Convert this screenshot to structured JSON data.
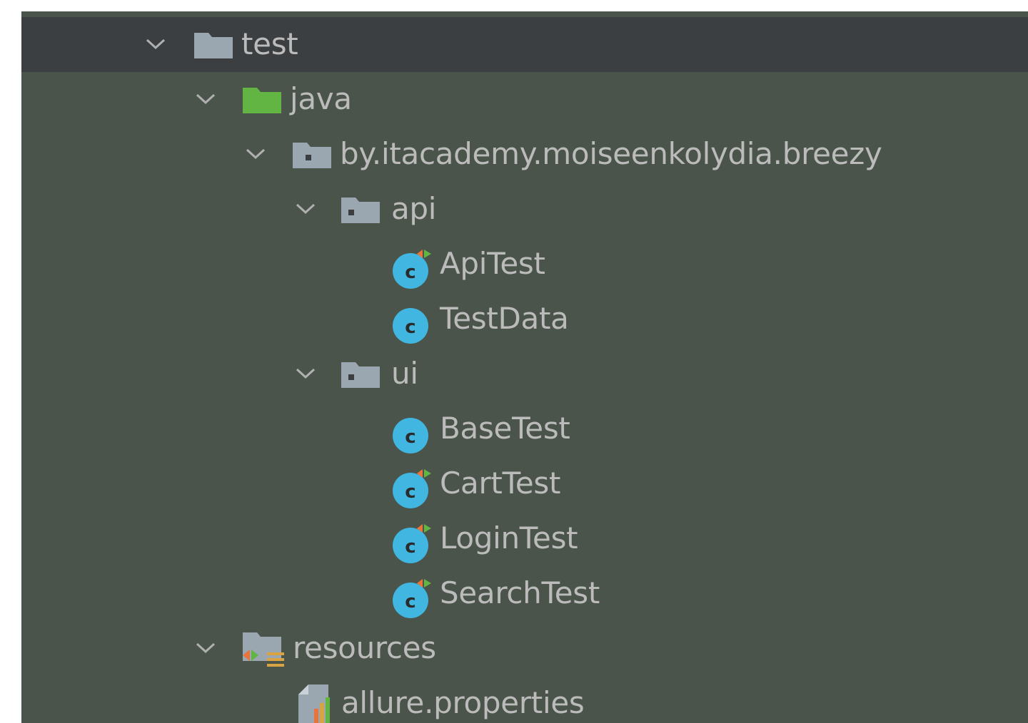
{
  "tree": {
    "root": {
      "label": "test",
      "expanded": true,
      "icon": "folder-icon"
    },
    "java": {
      "label": "java",
      "expanded": true,
      "icon": "source-root-folder-icon"
    },
    "package": {
      "label": "by.itacademy.moiseenkolydia.breezy",
      "expanded": true,
      "icon": "package-icon"
    },
    "api": {
      "label": "api",
      "expanded": true,
      "icon": "package-icon",
      "classes": [
        {
          "label": "ApiTest",
          "icon": "test-class-icon"
        },
        {
          "label": "TestData",
          "icon": "class-icon"
        }
      ]
    },
    "ui": {
      "label": "ui",
      "expanded": true,
      "icon": "package-icon",
      "classes": [
        {
          "label": "BaseTest",
          "icon": "class-icon"
        },
        {
          "label": "CartTest",
          "icon": "test-class-icon"
        },
        {
          "label": "LoginTest",
          "icon": "test-class-icon"
        },
        {
          "label": "SearchTest",
          "icon": "test-class-icon"
        }
      ]
    },
    "resources": {
      "label": "resources",
      "expanded": true,
      "icon": "resources-root-folder-icon",
      "files": [
        {
          "label": "allure.properties",
          "icon": "properties-file-icon"
        }
      ]
    }
  },
  "colors": {
    "background": "#4a544a",
    "selected_row": "#3c3f41",
    "text": "#bbbbbb",
    "folder": "#9aa7b0",
    "source_folder": "#62b543",
    "class_badge": "#40b6e0"
  }
}
